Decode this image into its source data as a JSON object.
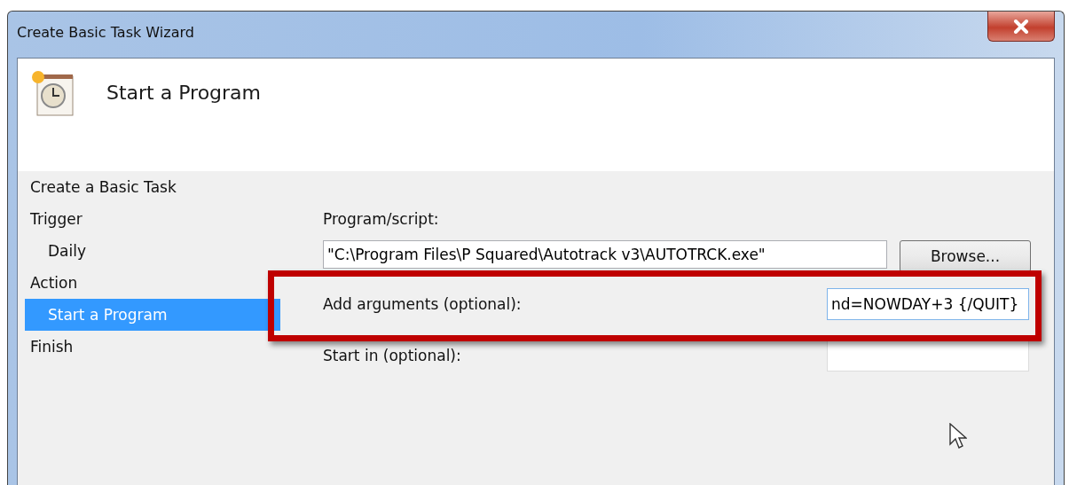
{
  "window": {
    "title": "Create Basic Task Wizard"
  },
  "header": {
    "title": "Start a Program"
  },
  "sidebar": {
    "items": [
      {
        "label": "Create a Basic Task",
        "selected": false
      },
      {
        "label": "Trigger",
        "selected": false,
        "children": [
          {
            "label": "Daily",
            "selected": false
          }
        ]
      },
      {
        "label": "Action",
        "selected": false,
        "children": [
          {
            "label": "Start a Program",
            "selected": true
          }
        ]
      },
      {
        "label": "Finish",
        "selected": false
      }
    ]
  },
  "form": {
    "program_label": "Program/script:",
    "program_value": "\"C:\\Program Files\\P Squared\\Autotrack v3\\AUTOTRCK.exe\"",
    "browse_button": "Browse...",
    "arguments_label": "Add arguments (optional):",
    "arguments_value": "nd=NOWDAY+3 {/QUIT}",
    "start_in_label": "Start in (optional):"
  }
}
